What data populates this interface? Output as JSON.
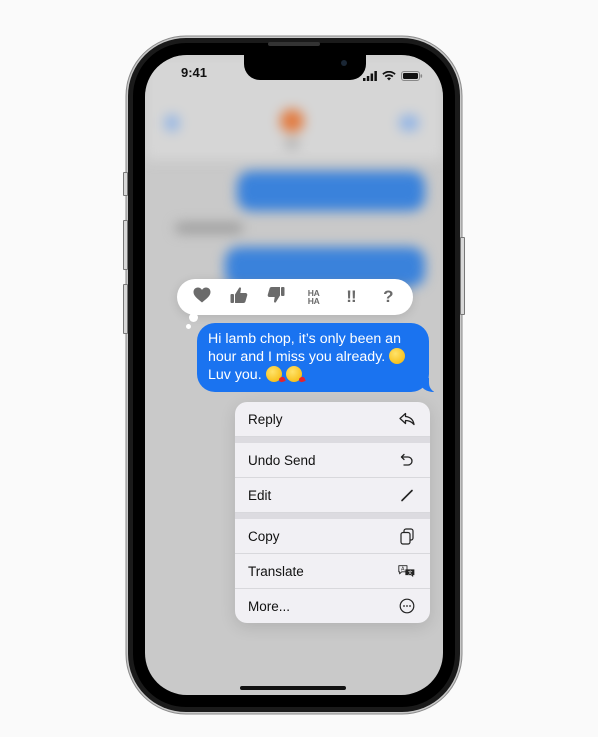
{
  "status_bar": {
    "time": "9:41",
    "icons": [
      "cellular-signal-icon",
      "wifi-icon",
      "battery-icon"
    ]
  },
  "background_conversation": {
    "blurred": true,
    "accent_color": "#3a82db",
    "avatar_color": "#e27a3f"
  },
  "reactions": {
    "items": [
      {
        "name": "heart",
        "icon": "heart-icon"
      },
      {
        "name": "thumbs-up",
        "icon": "thumbs-up-icon"
      },
      {
        "name": "thumbs-down",
        "icon": "thumbs-down-icon"
      },
      {
        "name": "haha",
        "icon": "haha-icon",
        "label_top": "HA",
        "label_bottom": "HA"
      },
      {
        "name": "emphasize",
        "icon": "double-exclamation-icon",
        "label": "!!"
      },
      {
        "name": "question",
        "icon": "question-mark-icon",
        "label": "?"
      }
    ]
  },
  "message": {
    "line1": "Hi lamb chop, it’s only been an",
    "line2": "hour and I miss you already.",
    "line3": "Luv you.",
    "bubble_color": "#1a73f0",
    "emojis": [
      "slightly-frowning-face",
      "face-blowing-kiss",
      "face-blowing-kiss"
    ]
  },
  "context_menu": {
    "groups": [
      [
        {
          "label": "Reply",
          "icon": "reply-icon"
        }
      ],
      [
        {
          "label": "Undo Send",
          "icon": "undo-icon"
        },
        {
          "label": "Edit",
          "icon": "pencil-icon"
        }
      ],
      [
        {
          "label": "Copy",
          "icon": "copy-icon"
        },
        {
          "label": "Translate",
          "icon": "translate-icon"
        },
        {
          "label": "More...",
          "icon": "more-icon"
        }
      ]
    ]
  }
}
